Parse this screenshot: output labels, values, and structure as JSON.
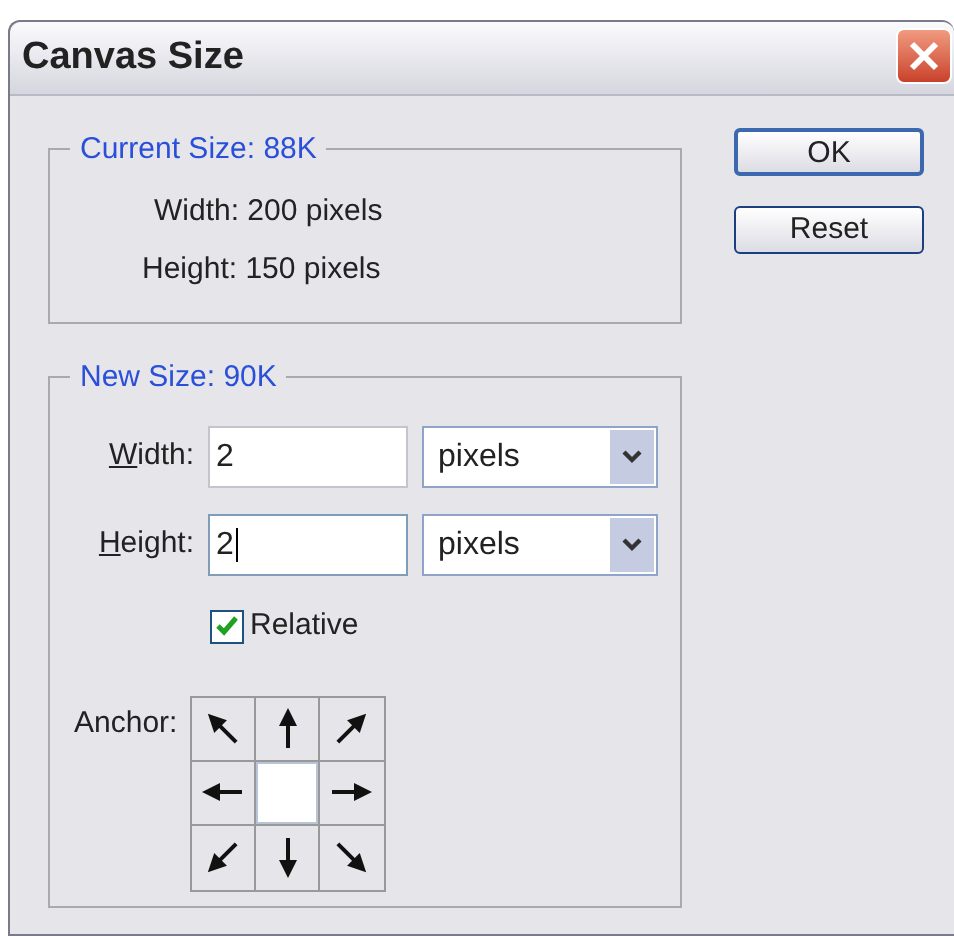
{
  "window": {
    "title": "Canvas Size"
  },
  "current_size": {
    "legend": "Current Size:  88K",
    "width": "Width: 200 pixels",
    "height": "Height: 150 pixels"
  },
  "buttons": [
    {
      "label": "OK",
      "default": true
    },
    {
      "label": "Reset",
      "default": false
    }
  ],
  "new_size": {
    "legend": "New Size:  90K",
    "fields": [
      {
        "label": "Width:",
        "value": "2",
        "unit": "pixels",
        "focused": false
      },
      {
        "label": "Height:",
        "value": "2",
        "unit": "pixels",
        "focused": true
      }
    ],
    "relative": {
      "label": "Relative",
      "checked": true
    },
    "anchor": {
      "label": "Anchor:",
      "cells": [
        {
          "selected": false
        },
        {
          "selected": false
        },
        {
          "selected": false
        },
        {
          "selected": false
        },
        {
          "selected": true
        },
        {
          "selected": false
        },
        {
          "selected": false
        },
        {
          "selected": false
        },
        {
          "selected": false
        }
      ]
    }
  }
}
